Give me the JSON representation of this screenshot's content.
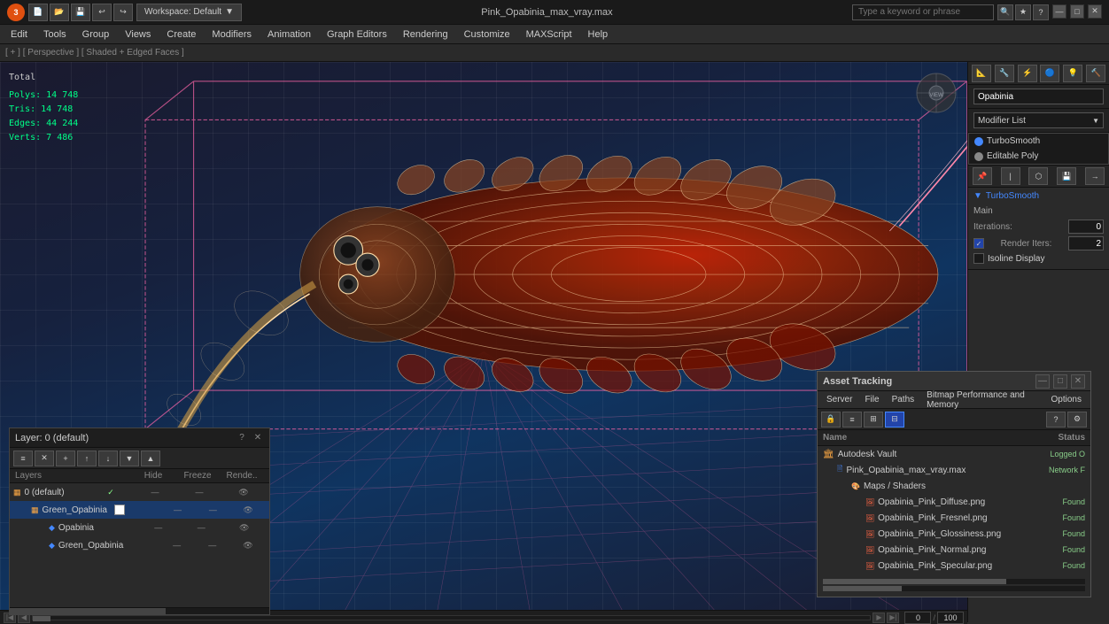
{
  "titlebar": {
    "app_name": "3ds Max",
    "title": "Pink_Opabinia_max_vray.max",
    "workspace_label": "Workspace: Default",
    "search_placeholder": "Type a keyword or phrase",
    "minimize": "—",
    "maximize": "□",
    "close": "✕"
  },
  "menubar": {
    "items": [
      "Edit",
      "Tools",
      "Group",
      "Views",
      "Create",
      "Modifiers",
      "Animation",
      "Graph Editors",
      "Rendering",
      "Customize",
      "MAXScript",
      "Help"
    ]
  },
  "infobar": {
    "label": "[ + ] [ Perspective ] [ Shaded + Edged Faces ]"
  },
  "stats": {
    "title": "Total",
    "polys_label": "Polys:",
    "polys_value": "14 748",
    "tris_label": "Tris:",
    "tris_value": "14 748",
    "edges_label": "Edges:",
    "edges_value": "44 244",
    "verts_label": "Verts:",
    "verts_value": "7 486"
  },
  "right_panel": {
    "object_name": "Opabinia",
    "modifier_list_label": "Modifier List",
    "modifiers": [
      {
        "name": "TurboSmooth",
        "active": true
      },
      {
        "name": "Editable Poly",
        "active": false
      }
    ],
    "section_name": "TurboSmooth",
    "main_section": "Main",
    "iterations_label": "Iterations:",
    "iterations_value": "0",
    "render_iters_label": "Render Iters:",
    "render_iters_value": "2",
    "isoline_label": "Isoline Display",
    "isoline_checked": false
  },
  "layers_panel": {
    "title": "Layer: 0 (default)",
    "layers_label": "Layers",
    "col_hide": "Hide",
    "col_freeze": "Freeze",
    "col_render": "Rende..",
    "rows": [
      {
        "indent": 0,
        "name": "0 (default)",
        "checked": true,
        "icon": "layer",
        "hide": "—",
        "freeze": "—",
        "render": "👁"
      },
      {
        "indent": 1,
        "name": "Green_Opabinia",
        "checked": false,
        "icon": "layer",
        "selected": true,
        "hide": "—",
        "freeze": "—",
        "render": "👁"
      },
      {
        "indent": 2,
        "name": "Opabinia",
        "checked": false,
        "icon": "obj",
        "hide": "—",
        "freeze": "—",
        "render": "👁"
      },
      {
        "indent": 2,
        "name": "Green_Opabinia",
        "checked": false,
        "icon": "obj",
        "hide": "—",
        "freeze": "—",
        "render": "👁"
      }
    ]
  },
  "asset_panel": {
    "title": "Asset Tracking",
    "menu_items": [
      "Server",
      "File",
      "Paths",
      "Bitmap Performance and Memory",
      "Options"
    ],
    "col_name": "Name",
    "col_status": "Status",
    "rows": [
      {
        "indent": 0,
        "name": "Autodesk Vault",
        "icon": "vault",
        "status": "Logged O",
        "indent_level": 0
      },
      {
        "indent": 1,
        "name": "Pink_Opabinia_max_vray.max",
        "icon": "file",
        "status": "Network F",
        "indent_level": 1
      },
      {
        "indent": 2,
        "name": "Maps / Shaders",
        "icon": "maps",
        "status": "",
        "indent_level": 2
      },
      {
        "indent": 3,
        "name": "Opabinia_Pink_Diffuse.png",
        "icon": "png",
        "status": "Found",
        "indent_level": 3
      },
      {
        "indent": 3,
        "name": "Opabinia_Pink_Fresnel.png",
        "icon": "png",
        "status": "Found",
        "indent_level": 3
      },
      {
        "indent": 3,
        "name": "Opabinia_Pink_Glossiness.png",
        "icon": "png",
        "status": "Found",
        "indent_level": 3
      },
      {
        "indent": 3,
        "name": "Opabinia_Pink_Normal.png",
        "icon": "png",
        "status": "Found",
        "indent_level": 3
      },
      {
        "indent": 3,
        "name": "Opabinia_Pink_Specular.png",
        "icon": "png",
        "status": "Found",
        "indent_level": 3
      }
    ]
  }
}
